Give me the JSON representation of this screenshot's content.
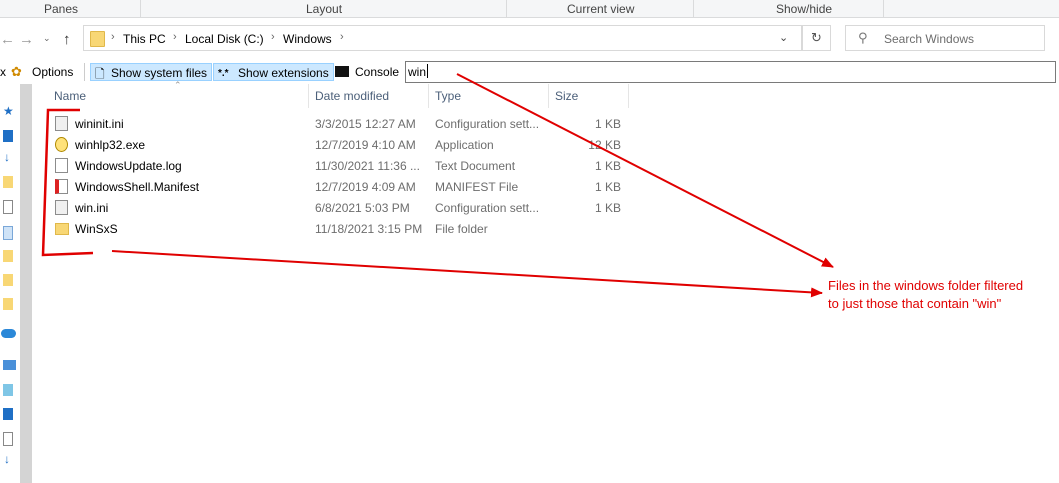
{
  "ribbon": {
    "groups": [
      "Panes",
      "Layout",
      "Current view",
      "Show/hide"
    ]
  },
  "nav": {
    "back_glyph": "←",
    "forward_glyph": "→",
    "up_glyph": "↑",
    "breadcrumbs": [
      "This PC",
      "Local Disk (C:)",
      "Windows"
    ],
    "search_placeholder": "Search Windows"
  },
  "toolbar": {
    "options_prefix": "x",
    "options_label": "Options",
    "show_system_files": "Show system files",
    "show_extensions": "Show extensions",
    "console": "Console",
    "filter_value": "win"
  },
  "columns": {
    "name": "Name",
    "date": "Date modified",
    "type": "Type",
    "size": "Size"
  },
  "files": [
    {
      "name": "wininit.ini",
      "date": "3/3/2015 12:27 AM",
      "type": "Configuration sett...",
      "size": "1 KB",
      "icon": "config-file-icon"
    },
    {
      "name": "winhlp32.exe",
      "date": "12/7/2019 4:10 AM",
      "type": "Application",
      "size": "12 KB",
      "icon": "application-icon"
    },
    {
      "name": "WindowsUpdate.log",
      "date": "11/30/2021 11:36 ...",
      "type": "Text Document",
      "size": "1 KB",
      "icon": "text-document-icon"
    },
    {
      "name": "WindowsShell.Manifest",
      "date": "12/7/2019 4:09 AM",
      "type": "MANIFEST File",
      "size": "1 KB",
      "icon": "manifest-file-icon"
    },
    {
      "name": "win.ini",
      "date": "6/8/2021 5:03 PM",
      "type": "Configuration sett...",
      "size": "1 KB",
      "icon": "config-file-icon"
    },
    {
      "name": "WinSxS",
      "date": "11/18/2021 3:15 PM",
      "type": "File folder",
      "size": "",
      "icon": "folder-icon"
    }
  ],
  "annotation": {
    "line1": "Files in the windows folder filtered",
    "line2": "to just those that contain \"win\"",
    "color": "#e00000"
  },
  "colors": {
    "header_text": "#4c607a",
    "active_button_bg": "#cce8ff",
    "annotation": "#e00000"
  }
}
